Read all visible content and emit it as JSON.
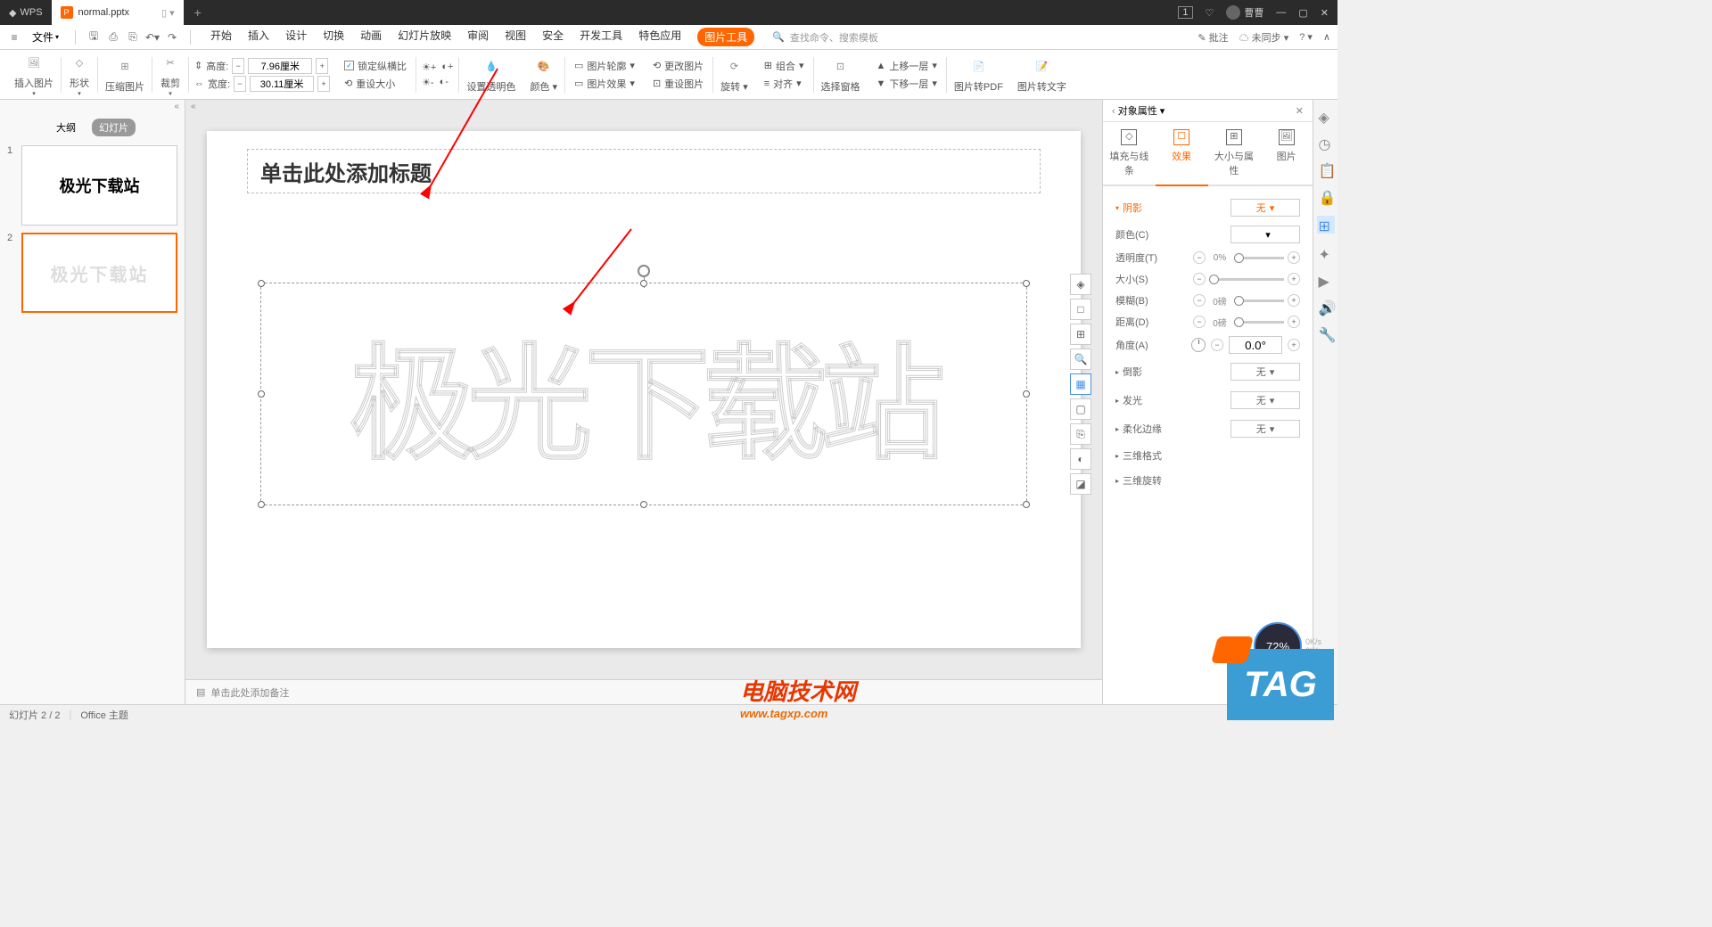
{
  "titlebar": {
    "app": "WPS",
    "filename": "normal.pptx",
    "newtab": "+",
    "user": "曹曹",
    "badge": "1"
  },
  "menubar": {
    "file": "文件",
    "tabs": [
      "开始",
      "插入",
      "设计",
      "切换",
      "动画",
      "幻灯片放映",
      "审阅",
      "视图",
      "安全",
      "开发工具",
      "特色应用",
      "图片工具"
    ],
    "search_placeholder": "查找命令、搜索模板",
    "annotate": "批注",
    "sync": "未同步"
  },
  "ribbon": {
    "insert_pic": "插入图片",
    "shape": "形状",
    "compress": "压缩图片",
    "crop": "裁剪",
    "height_label": "高度:",
    "height_value": "7.96厘米",
    "width_label": "宽度:",
    "width_value": "30.11厘米",
    "lock_ratio": "锁定纵横比",
    "reset_size": "重设大小",
    "set_transparent": "设置透明色",
    "recolor": "颜色",
    "outline": "图片轮廓",
    "effects": "图片效果",
    "change": "更改图片",
    "reset_pic": "重设图片",
    "rotate": "旋转",
    "group": "组合",
    "align": "对齐",
    "sel_pane": "选择窗格",
    "bring_fwd": "上移一层",
    "send_back": "下移一层",
    "to_pdf": "图片转PDF",
    "to_text": "图片转文字"
  },
  "slide_panel": {
    "outline": "大纲",
    "slides": "幻灯片",
    "thumb1": "极光下载站",
    "thumb2": "极光下载站"
  },
  "slide": {
    "title_placeholder": "单击此处添加标题",
    "watermark": "极光下载站"
  },
  "notes": {
    "placeholder": "单击此处添加备注"
  },
  "props": {
    "title": "对象属性",
    "tab_fill": "填充与线条",
    "tab_effect": "效果",
    "tab_size": "大小与属性",
    "tab_pic": "图片",
    "shadow": "阴影",
    "none": "无",
    "color": "颜色(C)",
    "transparency": "透明度(T)",
    "trans_val": "0%",
    "size": "大小(S)",
    "blur": "模糊(B)",
    "blur_val": "0磅",
    "distance": "距离(D)",
    "dist_val": "0磅",
    "angle": "角度(A)",
    "angle_val": "0.0°",
    "reflection": "倒影",
    "glow": "发光",
    "soft_edge": "柔化边缘",
    "3d_format": "三维格式",
    "3d_rotate": "三维旋转"
  },
  "statusbar": {
    "slide_info": "幻灯片 2 / 2",
    "theme": "Office 主题"
  },
  "overlay": {
    "site": "电脑技术网",
    "url": "www.tagxp.com",
    "tag": "TAG"
  },
  "speed": {
    "val": "72%",
    "up": "0K/s",
    "dn": "0K/s"
  }
}
